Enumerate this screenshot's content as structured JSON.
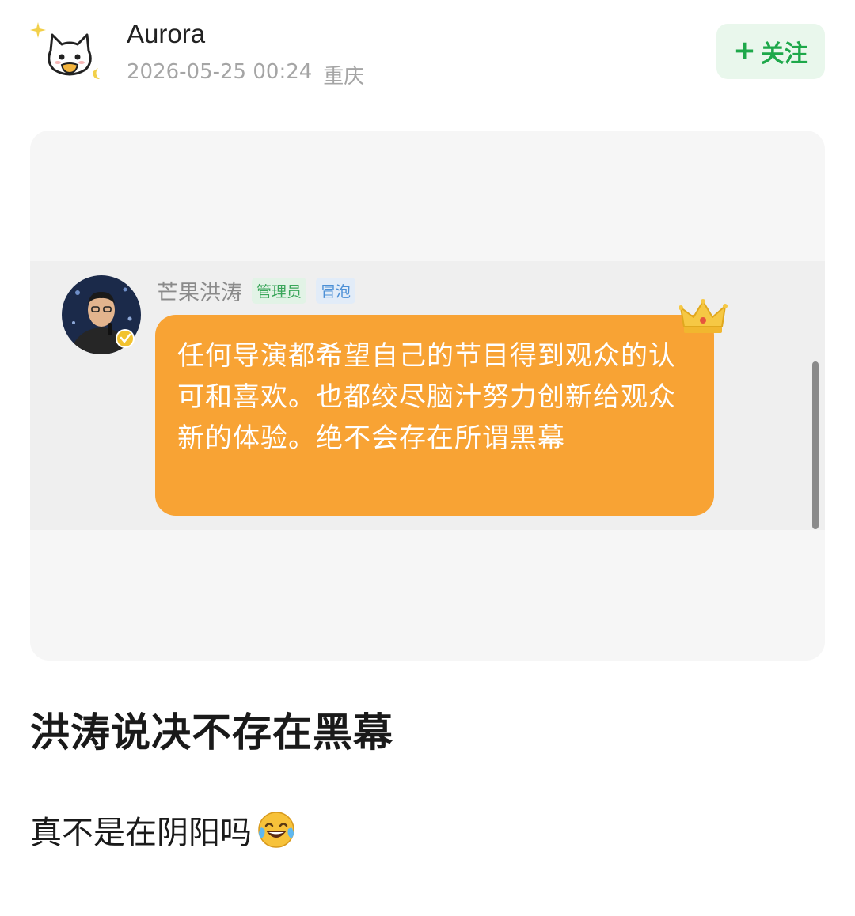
{
  "author": {
    "name": "Aurora",
    "timestamp": "2026-05-25 00:24",
    "location": "重庆",
    "avatar_icon": "cat-avatar-icon"
  },
  "follow_button": {
    "plus": "+",
    "label": "关注",
    "color": "#1ea84a",
    "background": "#e9f7ec"
  },
  "screenshot": {
    "chat_name": "芒果洪涛",
    "badge_admin": "管理员",
    "badge_bubble": "冒泡",
    "message": "任何导演都希望自己的节目得到观众的认可和喜欢。也都绞尽脑汁努力创新给观众新的体验。绝不会存在所谓黑幕",
    "bubble_color": "#f8a334"
  },
  "post": {
    "title": "洪涛说决不存在黑幕",
    "body": "真不是在阴阳吗",
    "emoji": "face-with-tears-of-joy"
  }
}
